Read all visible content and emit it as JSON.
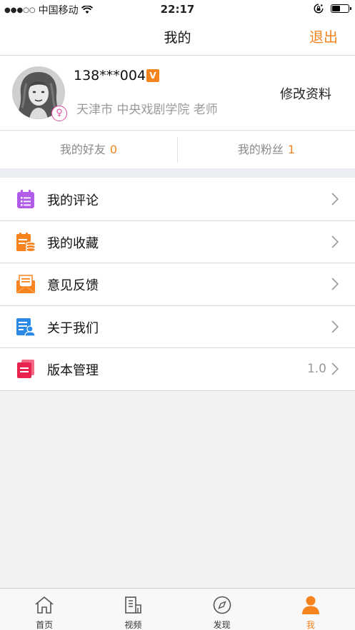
{
  "status_bar": {
    "signal_dots": "●●●○○",
    "carrier": "中国移动",
    "time": "22:17",
    "battery_level": 0.45,
    "icons": [
      "wifi-icon",
      "rotation-lock-icon",
      "battery-icon"
    ]
  },
  "nav": {
    "title": "我的",
    "logout_label": "退出"
  },
  "profile": {
    "phone": "138***004",
    "verified_badge": "V",
    "gender_symbol": "♀",
    "info": "天津市 中央戏剧学院 老师",
    "edit_label": "修改资料"
  },
  "stats": {
    "friends_label": "我的好友",
    "friends_count": "0",
    "fans_label": "我的粉丝",
    "fans_count": "1"
  },
  "menu": {
    "items": [
      {
        "label": "我的评论",
        "icon": "comments-icon",
        "value": ""
      },
      {
        "label": "我的收藏",
        "icon": "favorites-icon",
        "value": ""
      },
      {
        "label": "意见反馈",
        "icon": "feedback-icon",
        "value": ""
      },
      {
        "label": "关于我们",
        "icon": "about-icon",
        "value": ""
      },
      {
        "label": "版本管理",
        "icon": "version-icon",
        "value": "1.0"
      }
    ]
  },
  "tabs": [
    {
      "label": "首页",
      "icon": "home-icon",
      "active": false
    },
    {
      "label": "视频",
      "icon": "video-icon",
      "active": false
    },
    {
      "label": "发现",
      "icon": "compass-icon",
      "active": false
    },
    {
      "label": "我",
      "icon": "person-icon",
      "active": true
    }
  ],
  "colors": {
    "accent": "#f5841f",
    "gender": "#e24ba1",
    "comments_icon": "#b15ce8",
    "favorites_icon": "#f5841f",
    "feedback_icon": "#f5841f",
    "about_icon": "#2b8ae6",
    "version_icon": "#e8234f"
  }
}
